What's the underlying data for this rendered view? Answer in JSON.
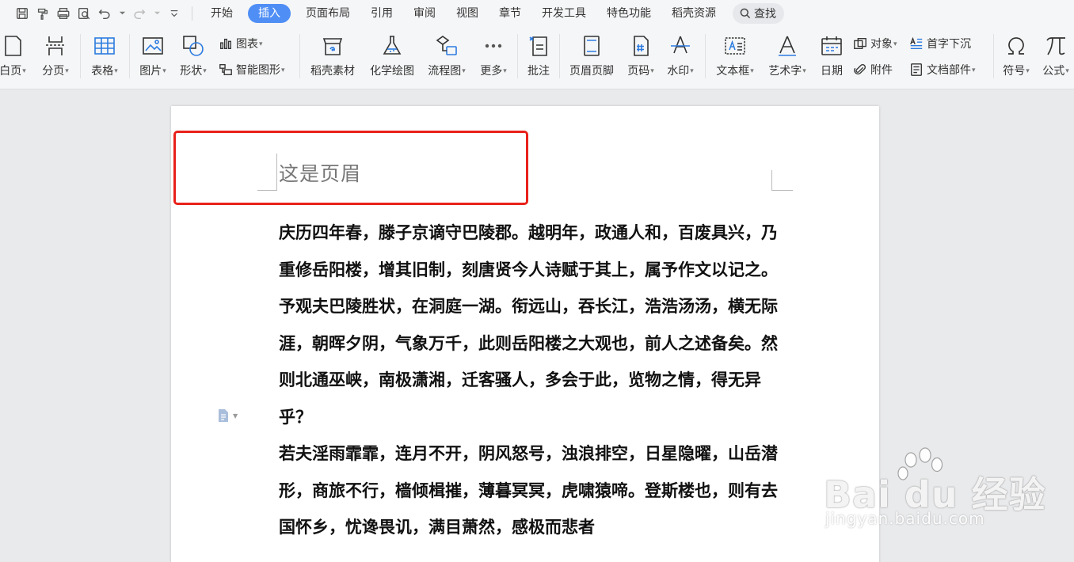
{
  "menubar": {
    "tabs": [
      "开始",
      "插入",
      "页面布局",
      "引用",
      "审阅",
      "视图",
      "章节",
      "开发工具",
      "特色功能",
      "稻壳资源"
    ],
    "active_tab": "插入",
    "search_label": "查找"
  },
  "ribbon": {
    "blank_page": "白页",
    "page_break": "分页",
    "table": "表格",
    "picture": "图片",
    "shape": "形状",
    "chart": "图表",
    "smart_art": "智能图形",
    "docer_material": "稻壳素材",
    "chem_draw": "化学绘图",
    "flowchart": "流程图",
    "more": "更多",
    "comment": "批注",
    "header_footer": "页眉页脚",
    "page_number": "页码",
    "watermark": "水印",
    "text_box": "文本框",
    "word_art": "艺术字",
    "date": "日期",
    "object": "对象",
    "attachment": "附件",
    "drop_cap": "首字下沉",
    "doc_parts": "文档部件",
    "symbol": "符号",
    "formula": "公式"
  },
  "document": {
    "header_text": "这是页眉",
    "paragraphs": [
      "庆历四年春，滕子京谪守巴陵郡。越明年，政通人和，百废具兴，乃重修岳阳楼，增其旧制，刻唐贤今人诗赋于其上，属予作文以记之。",
      "予观夫巴陵胜状，在洞庭一湖。衔远山，吞长江，浩浩汤汤，横无际涯，朝晖夕阴，气象万千，此则岳阳楼之大观也，前人之述备矣。然则北通巫峡，南极潇湘，迁客骚人，多会于此，览物之情，得无异乎？",
      "若夫淫雨霏霏，连月不开，阴风怒号，浊浪排空，日星隐曜，山岳潜形，商旅不行，樯倾楫摧，薄暮冥冥，虎啸猿啼。登斯楼也，则有去国怀乡，忧谗畏讥，满目萧然，感极而悲者"
    ]
  },
  "watermark": {
    "logo": "Bai du 经验",
    "url": "jingyan.baidu.com"
  },
  "colors": {
    "accent": "#4f8ef5",
    "highlight_box": "#e8221b",
    "ribbon_bg": "#f5f6f7",
    "canvas_bg": "#e9eaec"
  }
}
